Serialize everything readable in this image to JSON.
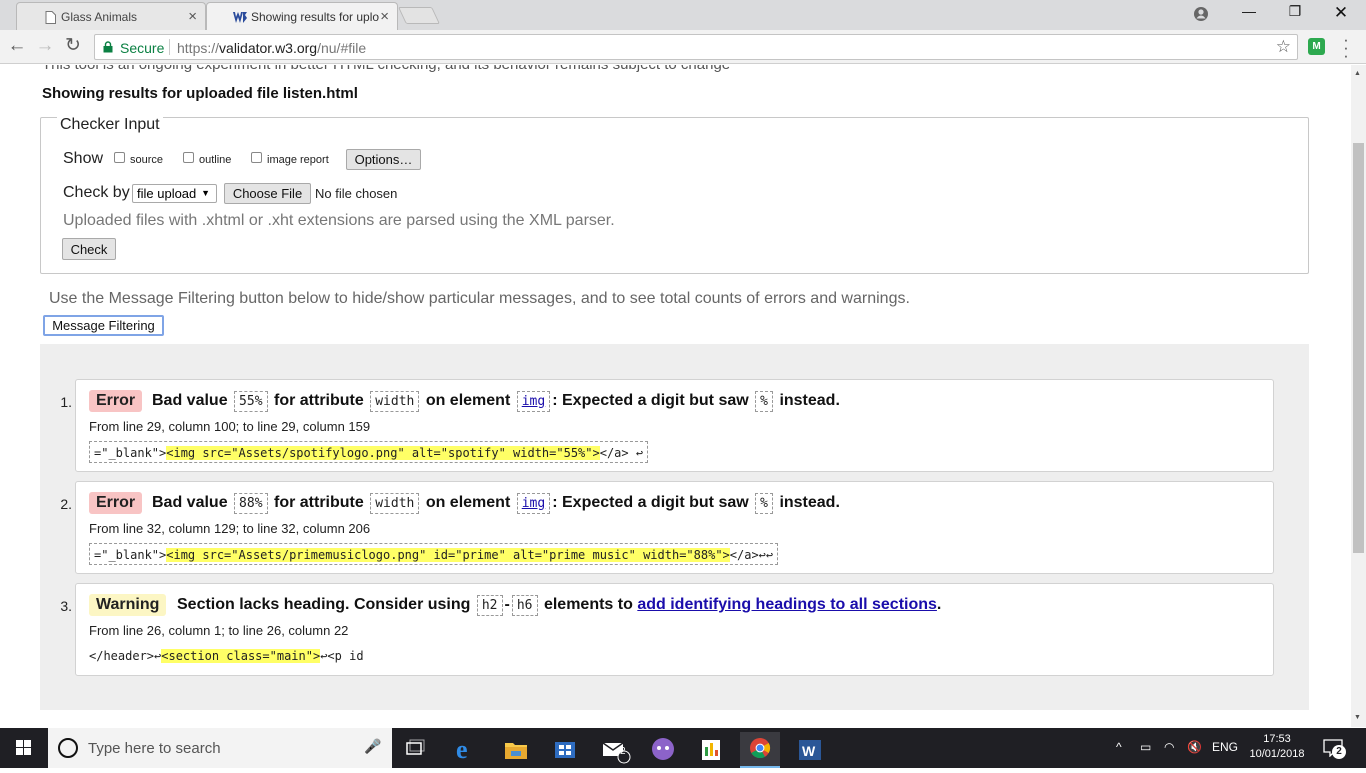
{
  "browser": {
    "tabs": [
      {
        "title": "Glass Animals",
        "active": false
      },
      {
        "title": "Showing results for uplo",
        "active": true
      }
    ],
    "secure_label": "Secure",
    "url_prefix": "https://",
    "url_host": "validator.w3.org",
    "url_path": "/nu/#file",
    "extension_label": "M"
  },
  "page": {
    "tagline": "This tool is an ongoing experiment in better HTML checking, and its behavior remains subject to change",
    "results_title": "Showing results for uploaded file listen.html",
    "checker": {
      "legend": "Checker Input",
      "show_label": "Show",
      "show_options": [
        "source",
        "outline",
        "image report"
      ],
      "options_button": "Options…",
      "check_by_label": "Check by",
      "check_by_value": "file upload",
      "choose_file_button": "Choose File",
      "no_file_text": "No file chosen",
      "hint": "Uploaded files with .xhtml or .xht extensions are parsed using the XML parser.",
      "check_button": "Check"
    },
    "filter_note": "Use the Message Filtering button below to hide/show particular messages, and to see total counts of errors and warnings.",
    "filter_button": "Message Filtering",
    "messages": [
      {
        "number": "1.",
        "type": "Error",
        "t1": "Bad value",
        "c1": "55%",
        "t2": "for attribute",
        "c2": "width",
        "t3": "on element",
        "c3": "img",
        "t4": ": Expected a digit but saw",
        "c4": "%",
        "t5": "instead.",
        "location": "From line 29, column 100; to line 29, column 159",
        "extract_pre": "=\"_blank\">",
        "extract_hl": "<img src=\"Assets/spotifylogo.png\" alt=\"spotify\" width=\"55%\">",
        "extract_post": "</a> ↩"
      },
      {
        "number": "2.",
        "type": "Error",
        "t1": "Bad value",
        "c1": "88%",
        "t2": "for attribute",
        "c2": "width",
        "t3": "on element",
        "c3": "img",
        "t4": ": Expected a digit but saw",
        "c4": "%",
        "t5": "instead.",
        "location": "From line 32, column 129; to line 32, column 206",
        "extract_pre": "=\"_blank\">",
        "extract_hl": "<img src=\"Assets/primemusiclogo.png\" id=\"prime\" alt=\"prime music\" width=\"88%\">",
        "extract_post": "</a>↩↩"
      },
      {
        "number": "3.",
        "type": "Warning",
        "t1": "Section lacks heading. Consider using",
        "c1": "h2",
        "dash": "-",
        "c2": "h6",
        "t2": "elements to",
        "link": "add identifying headings to all sections",
        "t3": ".",
        "location": "From line 26, column 1; to line 26, column 22",
        "extract_pre": "</header>↩",
        "extract_hl": "<section class=\"main\">",
        "extract_post": "↩<p id"
      }
    ]
  },
  "taskbar": {
    "search_placeholder": "Type here to search",
    "mail_badge": "2",
    "lang": "ENG",
    "time": "17:53",
    "date": "10/01/2018",
    "notification_count": "2"
  }
}
